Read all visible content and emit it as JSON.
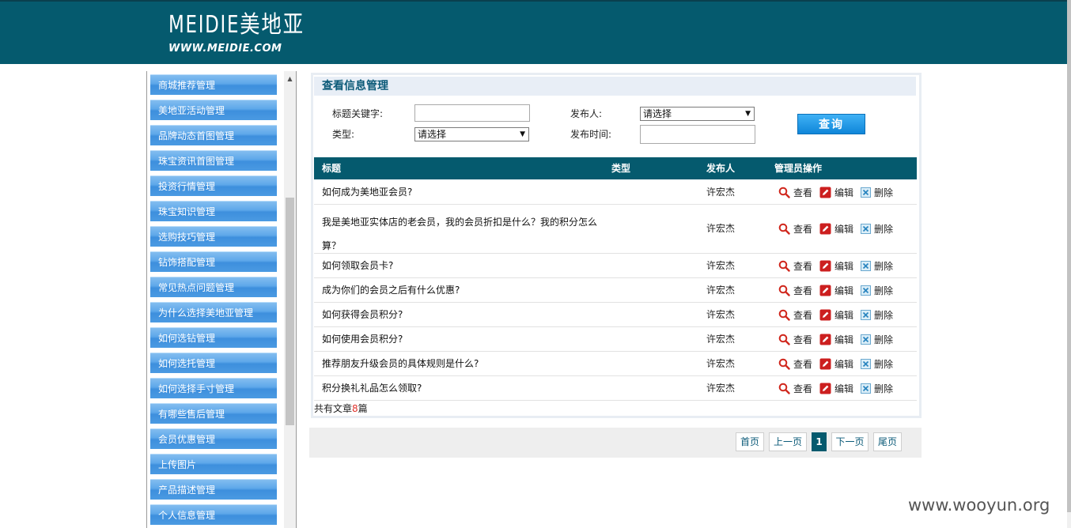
{
  "header": {
    "logo_main": "MEIDIE美地亚",
    "logo_sub": "WWW.MEIDIE.COM"
  },
  "sidebar": {
    "items": [
      "商城推荐管理",
      "美地亚活动管理",
      "品牌动态首图管理",
      "珠宝资讯首图管理",
      "投资行情管理",
      "珠宝知识管理",
      "选购技巧管理",
      "钻饰搭配管理",
      "常见热点问题管理",
      "为什么选择美地亚管理",
      "如何选钻管理",
      "如何选托管理",
      "如何选择手寸管理",
      "有哪些售后管理",
      "会员优惠管理",
      "上传图片",
      "产品描述管理",
      "个人信息管理"
    ]
  },
  "panel": {
    "title": "查看信息管理"
  },
  "filters": {
    "keyword_label": "标题关键字:",
    "keyword_value": "",
    "publisher_label": "发布人:",
    "publisher_value": "请选择",
    "type_label": "类型:",
    "type_value": "请选择",
    "time_label": "发布时间:",
    "time_value": "",
    "query_label": "查询"
  },
  "table": {
    "columns": {
      "title": "标题",
      "type": "类型",
      "author": "发布人",
      "ops": "管理员操作"
    },
    "ops_labels": {
      "view": "查看",
      "edit": "编辑",
      "delete": "删除"
    },
    "rows": [
      {
        "title_line1": "如何成为美地亚会员?",
        "title_line2": "",
        "type": "",
        "author": "许宏杰"
      },
      {
        "title_line1": "我是美地亚实体店的老会员，我的会员折扣是什么？我的积分怎么",
        "title_line2": "算？",
        "type": "",
        "author": "许宏杰"
      },
      {
        "title_line1": "如何领取会员卡?",
        "title_line2": "",
        "type": "",
        "author": "许宏杰"
      },
      {
        "title_line1": "成为你们的会员之后有什么优惠?",
        "title_line2": "",
        "type": "",
        "author": "许宏杰"
      },
      {
        "title_line1": "如何获得会员积分?",
        "title_line2": "",
        "type": "",
        "author": "许宏杰"
      },
      {
        "title_line1": "如何使用会员积分?",
        "title_line2": "",
        "type": "",
        "author": "许宏杰"
      },
      {
        "title_line1": "推荐朋友升级会员的具体规则是什么?",
        "title_line2": "",
        "type": "",
        "author": "许宏杰"
      },
      {
        "title_line1": "积分换礼礼品怎么领取?",
        "title_line2": "",
        "type": "",
        "author": "许宏杰"
      }
    ]
  },
  "summary": {
    "prefix": "共有文章",
    "count": "8",
    "suffix": "篇"
  },
  "pager": {
    "first": "首页",
    "prev": "上一页",
    "current": "1",
    "next": "下一页",
    "last": "尾页"
  },
  "watermark": "www.wooyun.org",
  "colors": {
    "header_bg": "#055a6e",
    "sidebar_item": "#4b9ae2",
    "accent_red": "#e0322b"
  }
}
